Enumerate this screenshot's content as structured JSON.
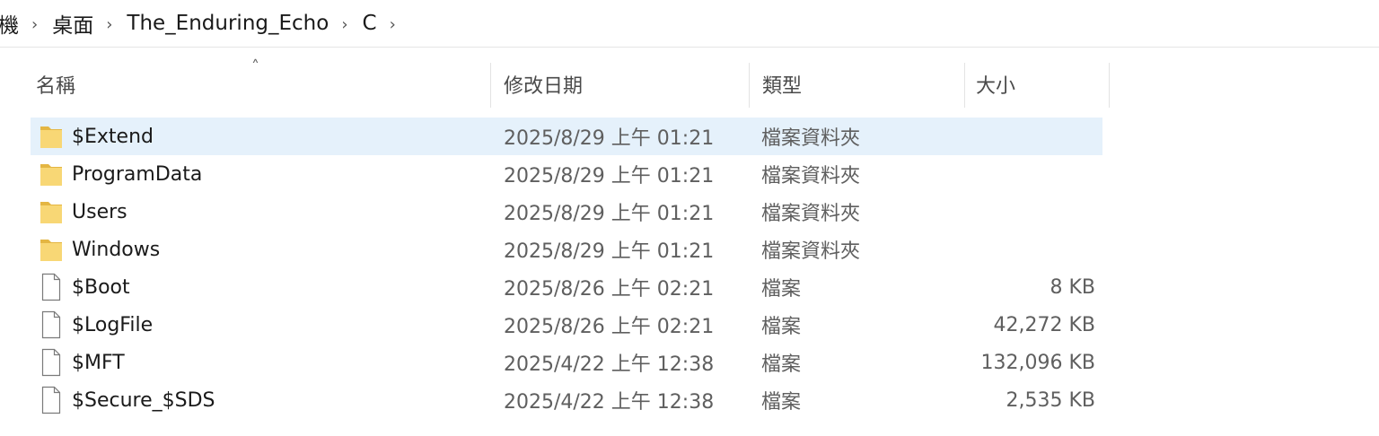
{
  "breadcrumb": {
    "items": [
      "機",
      "桌面",
      "The_Enduring_Echo",
      "C"
    ]
  },
  "columns": {
    "name": "名稱",
    "date": "修改日期",
    "type": "類型",
    "size": "大小"
  },
  "files": [
    {
      "name": "$Extend",
      "date": "2025/8/29 上午 01:21",
      "type": "檔案資料夾",
      "size": "",
      "icon": "folder-icon",
      "selected": true
    },
    {
      "name": "ProgramData",
      "date": "2025/8/29 上午 01:21",
      "type": "檔案資料夾",
      "size": "",
      "icon": "folder-icon"
    },
    {
      "name": "Users",
      "date": "2025/8/29 上午 01:21",
      "type": "檔案資料夾",
      "size": "",
      "icon": "folder-icon"
    },
    {
      "name": "Windows",
      "date": "2025/8/29 上午 01:21",
      "type": "檔案資料夾",
      "size": "",
      "icon": "folder-icon"
    },
    {
      "name": "$Boot",
      "date": "2025/8/26 上午 02:21",
      "type": "檔案",
      "size": "8 KB",
      "icon": "file-icon"
    },
    {
      "name": "$LogFile",
      "date": "2025/8/26 上午 02:21",
      "type": "檔案",
      "size": "42,272 KB",
      "icon": "file-icon"
    },
    {
      "name": "$MFT",
      "date": "2025/4/22 上午 12:38",
      "type": "檔案",
      "size": "132,096 KB",
      "icon": "file-icon"
    },
    {
      "name": "$Secure_$SDS",
      "date": "2025/4/22 上午 12:38",
      "type": "檔案",
      "size": "2,535 KB",
      "icon": "file-icon"
    }
  ],
  "colors": {
    "selected_row": "#e5f1fb",
    "folder_fill": "#f8d775",
    "folder_edge": "#e4b643"
  }
}
